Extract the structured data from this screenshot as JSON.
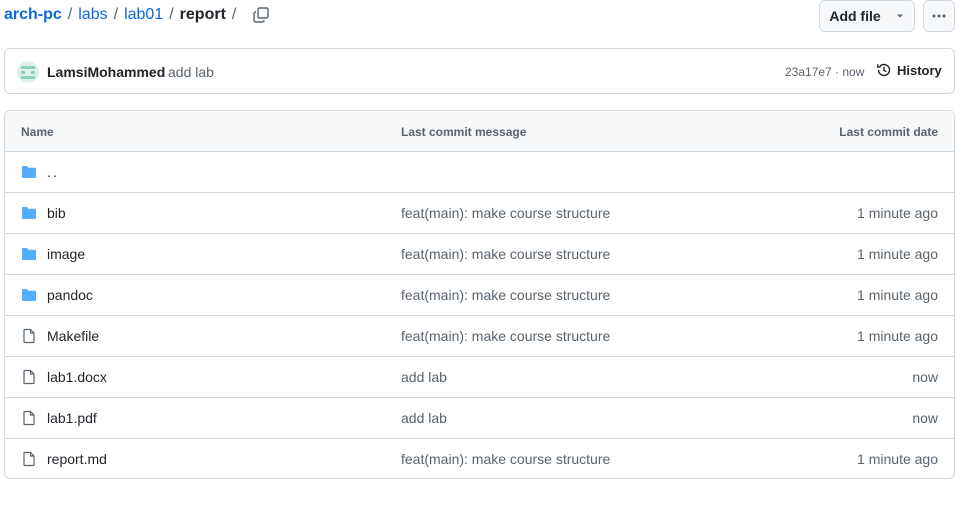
{
  "breadcrumb": {
    "repo": "arch-pc",
    "parts": [
      "labs",
      "lab01"
    ],
    "current": "report",
    "separator": "/"
  },
  "actions": {
    "add_file_label": "Add file"
  },
  "commit": {
    "author": "LamsiMohammed",
    "message": "add lab",
    "sha_time": "23a17e7 · now",
    "history_label": "History"
  },
  "table": {
    "headers": {
      "name": "Name",
      "message": "Last commit message",
      "date": "Last commit date"
    },
    "parent_label": "..",
    "rows": [
      {
        "type": "folder",
        "name": "bib",
        "message": "feat(main): make course structure",
        "date": "1 minute ago"
      },
      {
        "type": "folder",
        "name": "image",
        "message": "feat(main): make course structure",
        "date": "1 minute ago"
      },
      {
        "type": "folder",
        "name": "pandoc",
        "message": "feat(main): make course structure",
        "date": "1 minute ago"
      },
      {
        "type": "file",
        "name": "Makefile",
        "message": "feat(main): make course structure",
        "date": "1 minute ago"
      },
      {
        "type": "file",
        "name": "lab1.docx",
        "message": "add lab",
        "date": "now"
      },
      {
        "type": "file",
        "name": "lab1.pdf",
        "message": "add lab",
        "date": "now"
      },
      {
        "type": "file",
        "name": "report.md",
        "message": "feat(main): make course structure",
        "date": "1 minute ago"
      }
    ]
  },
  "colors": {
    "link": "#0969da",
    "folder": "#54aeff",
    "muted": "#59636e",
    "border": "#d1d9e0",
    "header_bg": "#f6f8fa"
  },
  "icons": {
    "copy": "copy-icon",
    "caret": "triangle-down-icon",
    "more": "kebab-horizontal-icon",
    "history": "history-icon",
    "folder": "folder-icon",
    "file": "file-icon"
  }
}
